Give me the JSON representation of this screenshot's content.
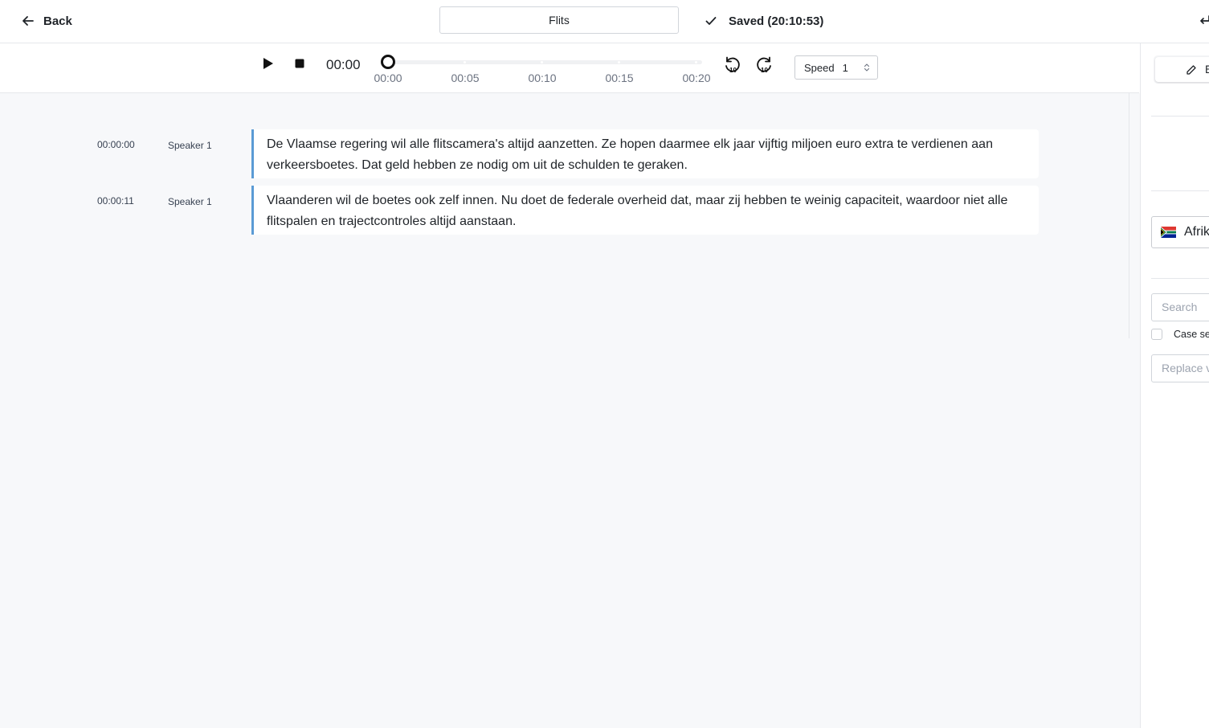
{
  "header": {
    "back_label": "Back",
    "title": "Flits",
    "saved_status": "Saved (20:10:53)"
  },
  "player": {
    "current_time": "00:00",
    "progress": 0,
    "ticks": [
      "00:00",
      "00:05",
      "00:10",
      "00:15",
      "00:20"
    ],
    "speed_label": "Speed",
    "speed_value": "1"
  },
  "segments": [
    {
      "time": "00:00:00",
      "speaker": "Speaker 1",
      "text": "De Vlaamse regering wil alle flitscamera's altijd aanzetten. Ze hopen daarmee elk jaar vijftig miljoen euro extra te verdienen aan verkeersboetes. Dat geld hebben ze nodig om uit de schulden te geraken."
    },
    {
      "time": "00:00:11",
      "speaker": "Speaker 1",
      "text": "Vlaanderen wil de boetes ook zelf innen. Nu doet de federale overheid dat, maar zij hebben te weinig capaciteit, waardoor niet alle flitspalen en trajectcontroles altijd aanstaan."
    }
  ],
  "right_panel": {
    "edit_tab_label": "E",
    "language": "Afrik",
    "search_placeholder": "Search",
    "case_label": "Case se",
    "replace_placeholder": "Replace v"
  },
  "colors": {
    "segment_accent": "#5b9bd5",
    "transcript_bg": "#f7f8fa"
  },
  "icons": {
    "back": "arrow-left-icon",
    "saved": "check-icon",
    "play": "play-icon",
    "stop": "stop-icon",
    "rewind": "rewind-10-icon",
    "forward": "forward-10-icon",
    "edit": "pencil-icon",
    "flag": "south-africa-flag-icon"
  }
}
